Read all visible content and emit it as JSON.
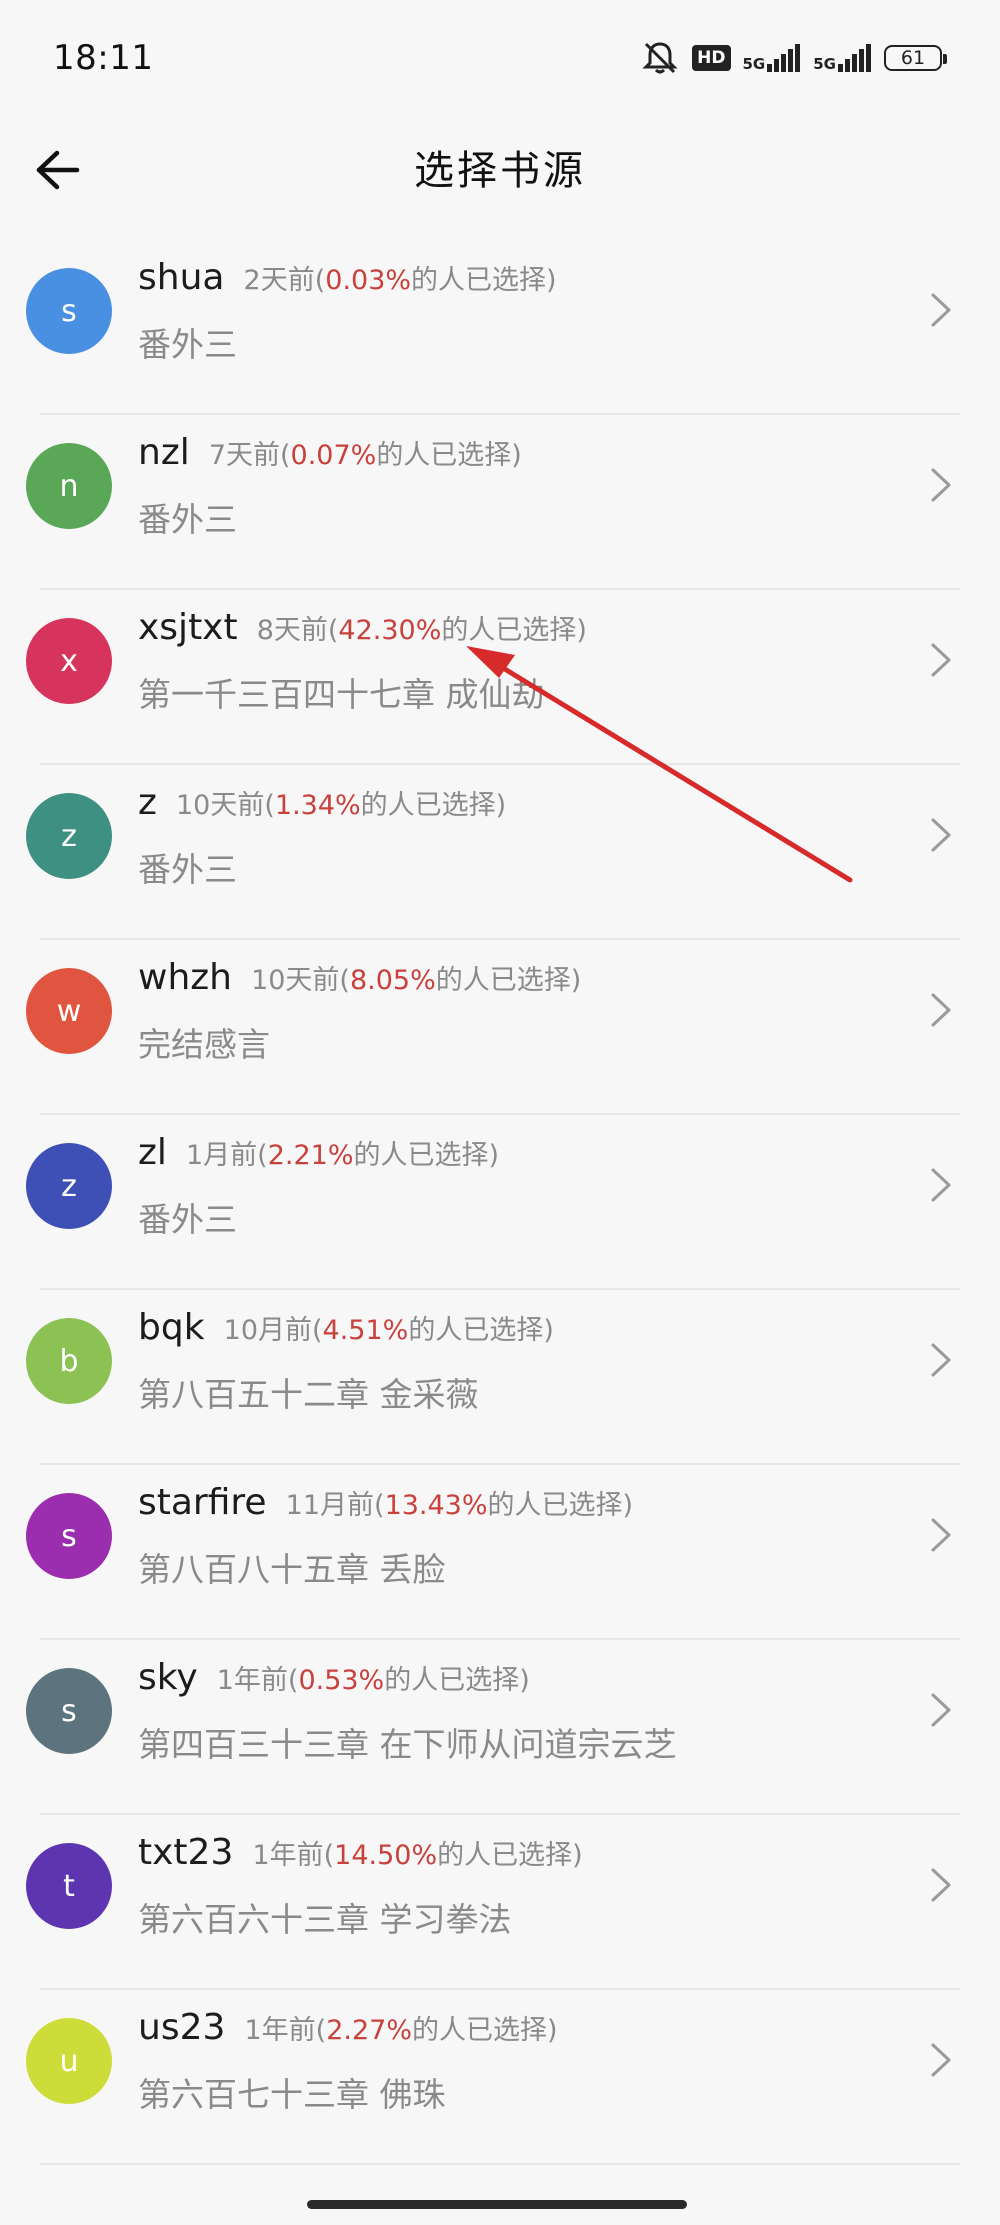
{
  "status_bar": {
    "time": "18:11",
    "hd_label": "HD",
    "net1": "5G",
    "net2": "5G",
    "battery": "61"
  },
  "header": {
    "title": "选择书源"
  },
  "sources": [
    {
      "avatar": "s",
      "color": "#4a90e2",
      "name": "shua",
      "time": "2天前(",
      "percent": "0.03%",
      "suffix": "的人已选择)",
      "chapter": "番外三"
    },
    {
      "avatar": "n",
      "color": "#5aa857",
      "name": "nzl",
      "time": "7天前(",
      "percent": "0.07%",
      "suffix": "的人已选择)",
      "chapter": "番外三"
    },
    {
      "avatar": "x",
      "color": "#d7345d",
      "name": "xsjtxt",
      "time": "8天前(",
      "percent": "42.30%",
      "suffix": "的人已选择)",
      "chapter": "第一千三百四十七章 成仙劫"
    },
    {
      "avatar": "z",
      "color": "#3d9082",
      "name": "z",
      "time": "10天前(",
      "percent": "1.34%",
      "suffix": "的人已选择)",
      "chapter": "番外三"
    },
    {
      "avatar": "w",
      "color": "#e05540",
      "name": "whzh",
      "time": "10天前(",
      "percent": "8.05%",
      "suffix": "的人已选择)",
      "chapter": "完结感言"
    },
    {
      "avatar": "z",
      "color": "#3e4fb5",
      "name": "zl",
      "time": "1月前(",
      "percent": "2.21%",
      "suffix": "的人已选择)",
      "chapter": "番外三"
    },
    {
      "avatar": "b",
      "color": "#8bc253",
      "name": "bqk",
      "time": "10月前(",
      "percent": "4.51%",
      "suffix": "的人已选择)",
      "chapter": "第八百五十二章 金采薇"
    },
    {
      "avatar": "s",
      "color": "#9a2eae",
      "name": "starfire",
      "time": "11月前(",
      "percent": "13.43%",
      "suffix": "的人已选择)",
      "chapter": "第八百八十五章 丢脸"
    },
    {
      "avatar": "s",
      "color": "#5d737e",
      "name": "sky",
      "time": "1年前(",
      "percent": "0.53%",
      "suffix": "的人已选择)",
      "chapter": "第四百三十三章 在下师从问道宗云芝"
    },
    {
      "avatar": "t",
      "color": "#5e35b1",
      "name": "txt23",
      "time": "1年前(",
      "percent": "14.50%",
      "suffix": "的人已选择)",
      "chapter": "第六百六十三章 学习拳法"
    },
    {
      "avatar": "u",
      "color": "#cddc39",
      "name": "us23",
      "time": "1年前(",
      "percent": "2.27%",
      "suffix": "的人已选择)",
      "chapter": "第六百七十三章 佛珠"
    }
  ]
}
